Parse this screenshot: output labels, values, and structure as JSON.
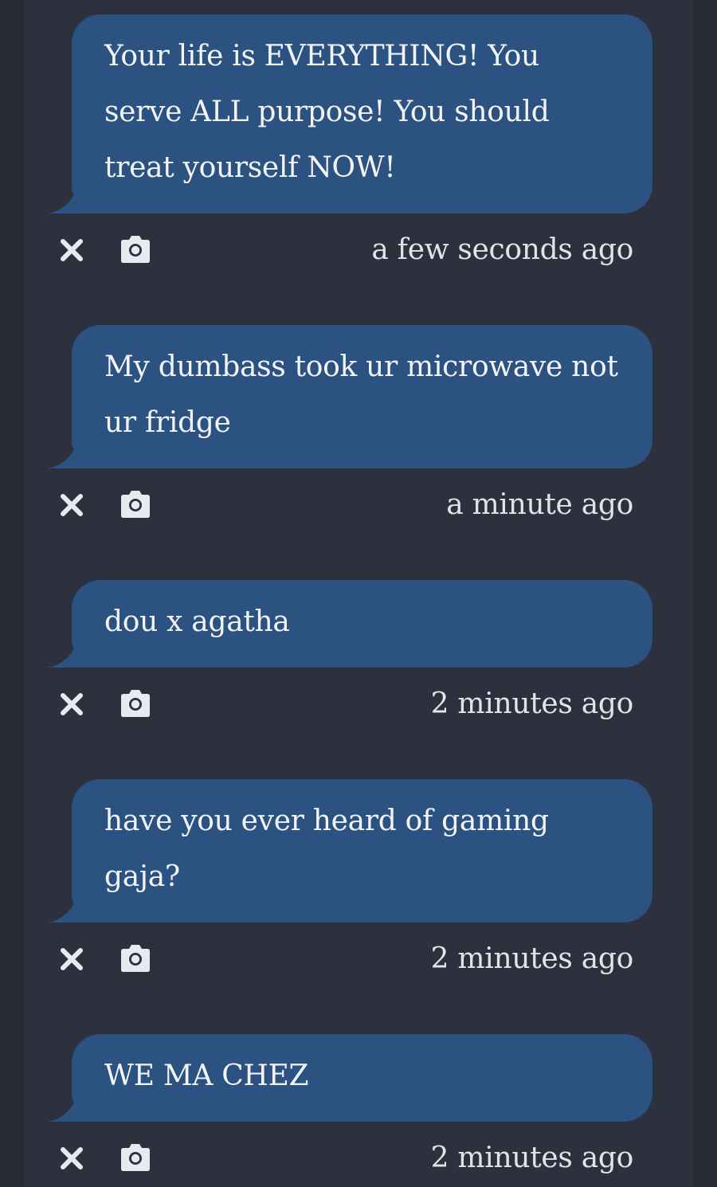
{
  "messages": [
    {
      "text": "Your life is EVERYTHING! You serve ALL purpose! You should treat yourself NOW!",
      "timestamp": "a few seconds ago",
      "delete_icon": "close-icon",
      "screenshot_icon": "camera-icon"
    },
    {
      "text": "My dumbass took ur microwave not ur fridge",
      "timestamp": "a minute ago",
      "delete_icon": "close-icon",
      "screenshot_icon": "camera-icon"
    },
    {
      "text": "dou x agatha",
      "timestamp": "2 minutes ago",
      "delete_icon": "close-icon",
      "screenshot_icon": "camera-icon"
    },
    {
      "text": "have you ever heard of gaming gaja?",
      "timestamp": "2 minutes ago",
      "delete_icon": "close-icon",
      "screenshot_icon": "camera-icon"
    },
    {
      "text": "WE MA CHEZ",
      "timestamp": "2 minutes ago",
      "delete_icon": "close-icon",
      "screenshot_icon": "camera-icon"
    }
  ],
  "colors": {
    "background": "#252a35",
    "feed_background": "#2c313d",
    "bubble": "#2c5282",
    "text": "#f2f4f7",
    "muted_text": "#dfe3ea",
    "icon": "#e8eaef"
  }
}
